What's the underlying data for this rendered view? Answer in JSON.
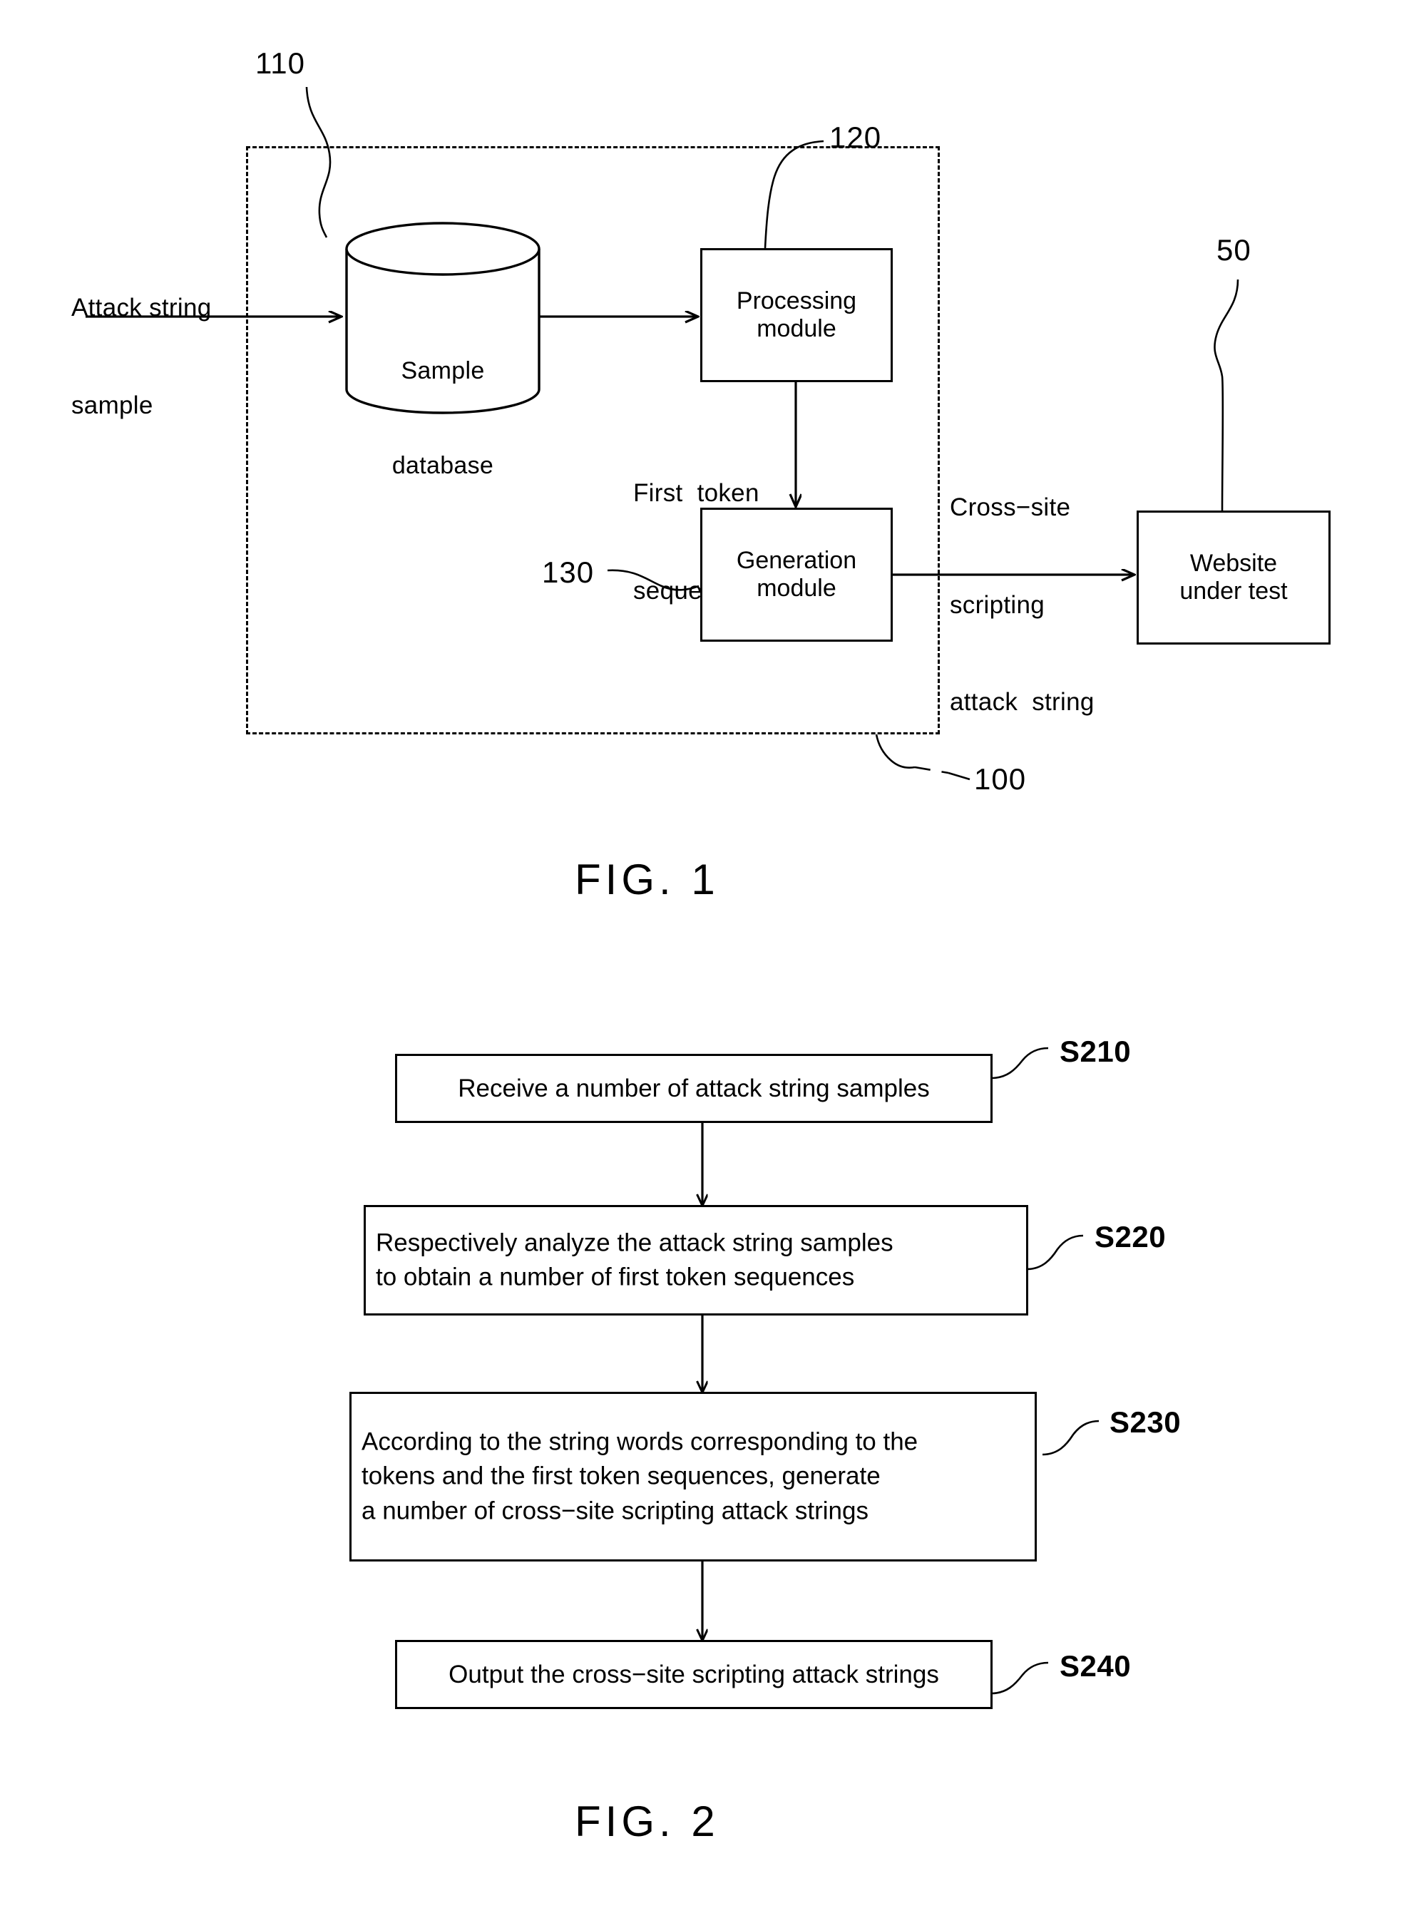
{
  "document": {
    "type": "patent-drawing-sheet",
    "figures": [
      "FIG. 1",
      "FIG. 2"
    ]
  },
  "fig1": {
    "caption": "FIG. 1",
    "system_ref": "100",
    "input_label": "Attack string\nsample",
    "input_label_line1": "Attack string",
    "input_label_line2": "sample",
    "database": {
      "ref": "110",
      "label_line1": "Sample",
      "label_line2": "database"
    },
    "processing_module": {
      "ref": "120",
      "label_line1": "Processing",
      "label_line2": "module"
    },
    "generation_module": {
      "ref": "130",
      "label_line1": "Generation",
      "label_line2": "module"
    },
    "website": {
      "ref": "50",
      "label_line1": "Website",
      "label_line2": "under  test"
    },
    "edge_first_token": {
      "line1": "First  token",
      "line2": "sequence"
    },
    "edge_xss_string": {
      "line1": "Cross−site",
      "line2": "scripting",
      "line3": "attack  string"
    }
  },
  "fig2": {
    "caption": "FIG. 2",
    "steps": [
      {
        "ref": "S210",
        "lines": [
          "Receive  a  number  of  attack  string  samples"
        ]
      },
      {
        "ref": "S220",
        "lines": [
          "Respectively  analyze  the  attack  string  samples",
          "to  obtain  a  number  of  first  token  sequences"
        ]
      },
      {
        "ref": "S230",
        "lines": [
          "According  to  the  string  words  corresponding  to  the",
          "tokens  and  the  first  token  sequences, generate",
          "a  number  of  cross−site  scripting  attack  strings"
        ]
      },
      {
        "ref": "S240",
        "lines": [
          "Output  the  cross−site  scripting  attack  strings"
        ]
      }
    ]
  },
  "colors": {
    "ink": "#000000",
    "paper": "#ffffff"
  }
}
